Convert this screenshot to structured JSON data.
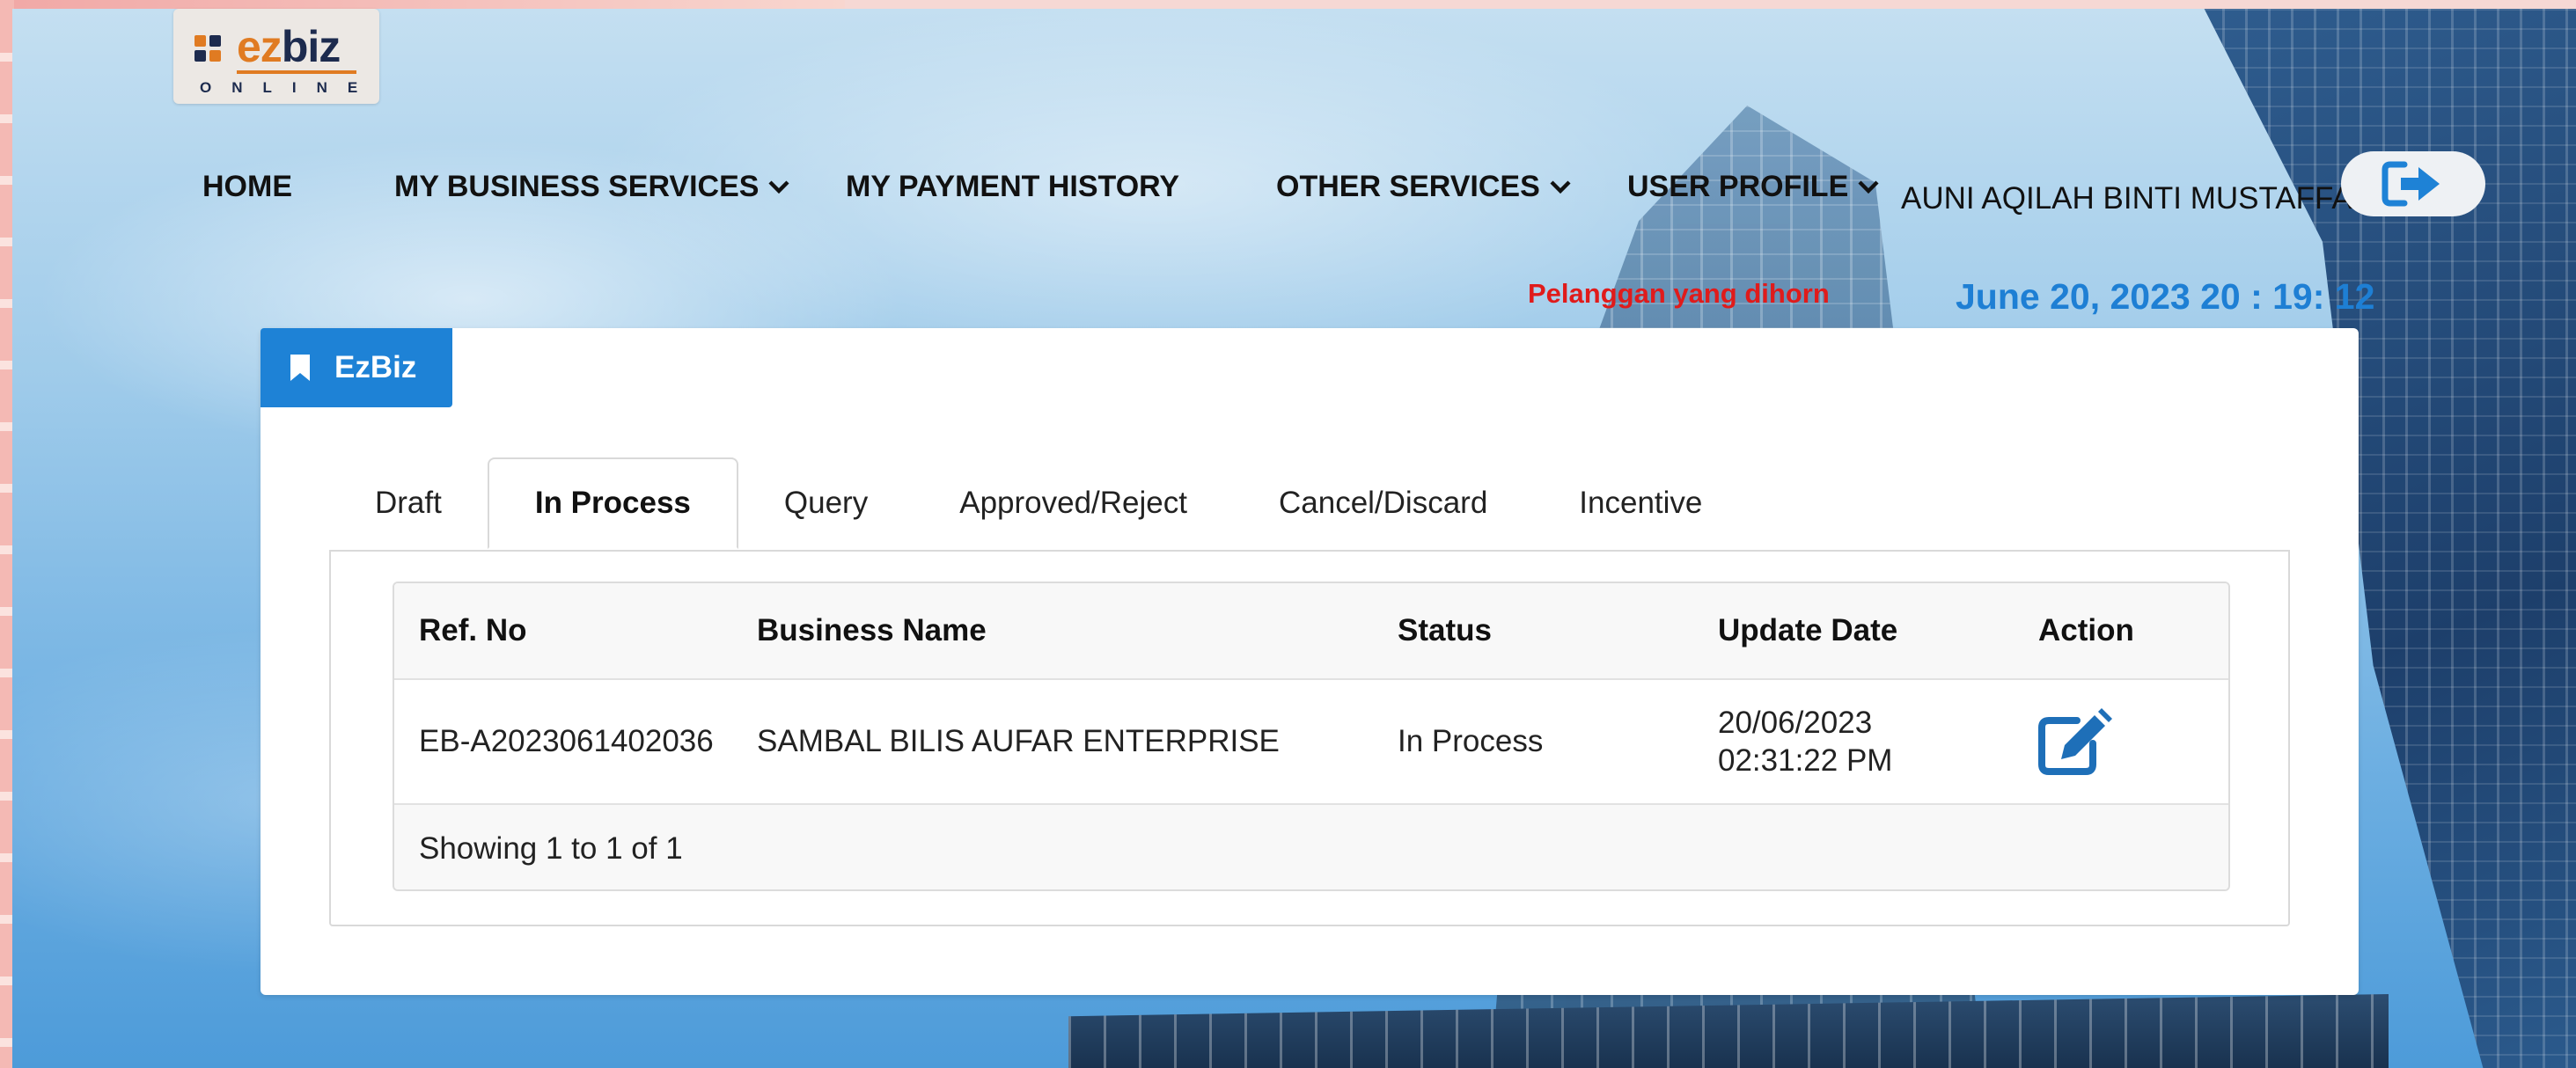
{
  "brand": {
    "logo_word_ez": "ez",
    "logo_word_biz": "biz",
    "logo_subtitle": "ONLINE",
    "colors": {
      "orange": "#e07b22",
      "navy": "#1d2b4e",
      "accent_blue": "#1e82d6",
      "notice_red": "#e01b1b"
    }
  },
  "nav": {
    "home": "HOME",
    "my_business_services": "MY BUSINESS SERVICES",
    "my_payment_history": "MY PAYMENT HISTORY",
    "other_services": "OTHER SERVICES",
    "user_profile": "USER PROFILE"
  },
  "user": {
    "name": "AUNI AQILAH BINTI MUSTAFFA",
    "logout_icon": "sign-out-icon"
  },
  "notice": "Pelanggan yang dihorn",
  "clock": "June 20, 2023 20 : 19: 12",
  "card": {
    "title": "EzBiz",
    "title_icon": "bookmark-icon"
  },
  "tabs": [
    {
      "label": "Draft",
      "active": false
    },
    {
      "label": "In Process",
      "active": true
    },
    {
      "label": "Query",
      "active": false
    },
    {
      "label": "Approved/Reject",
      "active": false
    },
    {
      "label": "Cancel/Discard",
      "active": false
    },
    {
      "label": "Incentive",
      "active": false
    }
  ],
  "table": {
    "headers": [
      "Ref. No",
      "Business Name",
      "Status",
      "Update Date",
      "Action"
    ],
    "rows": [
      {
        "ref_no": "EB-A2023061402036",
        "business_name": "SAMBAL BILIS AUFAR ENTERPRISE",
        "status": "In Process",
        "update_date": "20/06/2023",
        "update_time": "02:31:22 PM",
        "action_icon": "edit-icon"
      }
    ],
    "footer": "Showing 1 to 1 of 1"
  }
}
